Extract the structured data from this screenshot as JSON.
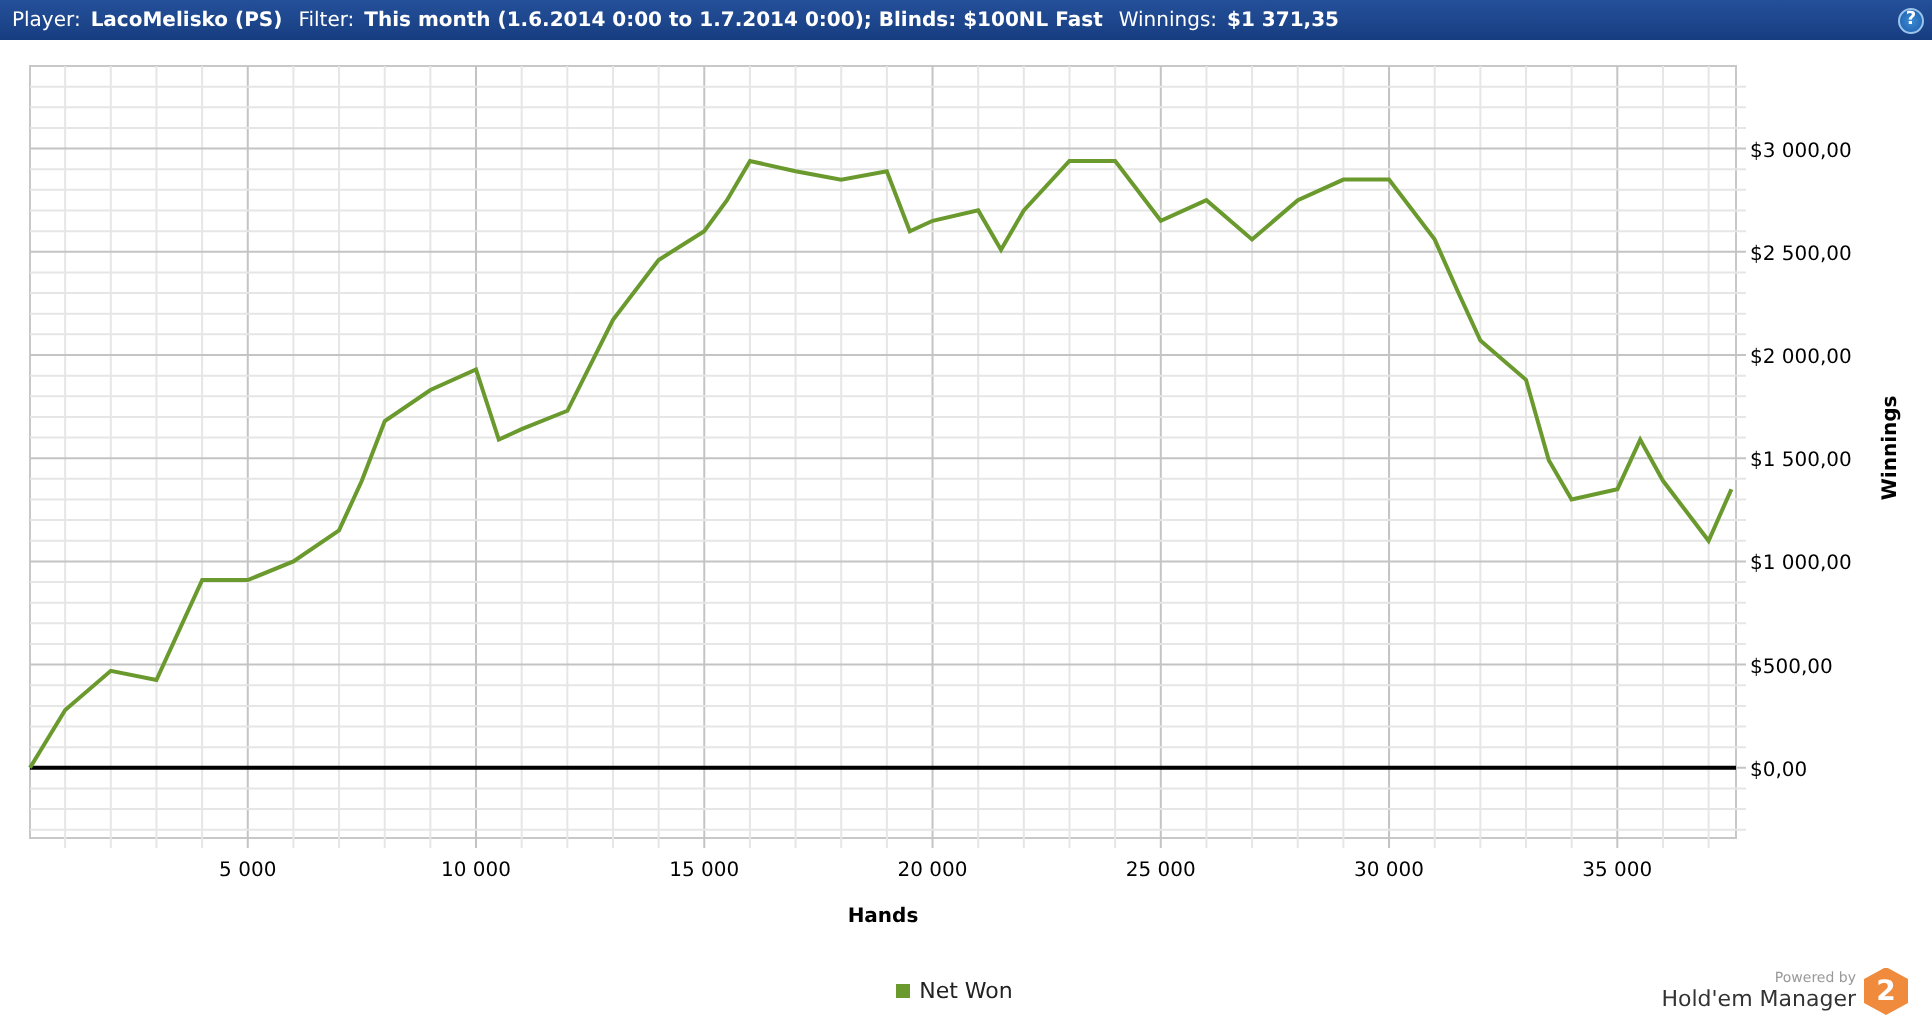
{
  "header": {
    "fields": [
      {
        "label": "Player:",
        "value": "LacoMelisko (PS)"
      },
      {
        "label": "Filter:",
        "value": "This month (1.6.2014 0:00 to 1.7.2014 0:00); Blinds: $100NL Fast"
      },
      {
        "label": "Winnings:",
        "value": "$1 371,35"
      }
    ],
    "help": "?"
  },
  "chart": {
    "chart_data": {
      "type": "line",
      "grid": true,
      "xlabel": "Hands",
      "ylabel": "Winnings",
      "xlim": [
        230,
        37600
      ],
      "ylim": [
        -340,
        3400
      ],
      "xticks": [
        {
          "value": 5000,
          "label": "5 000"
        },
        {
          "value": 10000,
          "label": "10 000"
        },
        {
          "value": 15000,
          "label": "15 000"
        },
        {
          "value": 20000,
          "label": "20 000"
        },
        {
          "value": 25000,
          "label": "25 000"
        },
        {
          "value": 30000,
          "label": "30 000"
        },
        {
          "value": 35000,
          "label": "35 000"
        }
      ],
      "yticks": [
        {
          "value": 0,
          "label": "$0,00"
        },
        {
          "value": 500,
          "label": "$500,00"
        },
        {
          "value": 1000,
          "label": "$1 000,00"
        },
        {
          "value": 1500,
          "label": "$1 500,00"
        },
        {
          "value": 2000,
          "label": "$2 000,00"
        },
        {
          "value": 2500,
          "label": "$2 500,00"
        },
        {
          "value": 3000,
          "label": "$3 000,00"
        }
      ],
      "x": [
        230,
        1000,
        2000,
        3000,
        4000,
        5000,
        6000,
        7000,
        7500,
        8000,
        9000,
        10000,
        10500,
        11000,
        12000,
        13000,
        14000,
        15000,
        15500,
        16000,
        17000,
        18000,
        19000,
        19500,
        20000,
        21000,
        21500,
        22000,
        23000,
        24000,
        25000,
        26000,
        27000,
        28000,
        29000,
        30000,
        31000,
        31500,
        32000,
        33000,
        33500,
        34000,
        35000,
        35500,
        36000,
        37000,
        37500
      ],
      "series": [
        {
          "name": "Net Won",
          "color": "#6a9a2e",
          "values": [
            0,
            280,
            470,
            425,
            910,
            910,
            1000,
            1150,
            1390,
            1680,
            1830,
            1930,
            1590,
            1640,
            1730,
            2170,
            2460,
            2600,
            2750,
            2940,
            2890,
            2850,
            2890,
            2600,
            2650,
            2700,
            2510,
            2700,
            2940,
            2940,
            2650,
            2750,
            2560,
            2750,
            2850,
            2850,
            2560,
            2310,
            2070,
            1880,
            1490,
            1300,
            1350,
            1590,
            1390,
            1100,
            1350
          ]
        }
      ]
    }
  },
  "logo": {
    "powered_by": "Powered by",
    "name": "Hold'em Manager",
    "badge": "2"
  }
}
